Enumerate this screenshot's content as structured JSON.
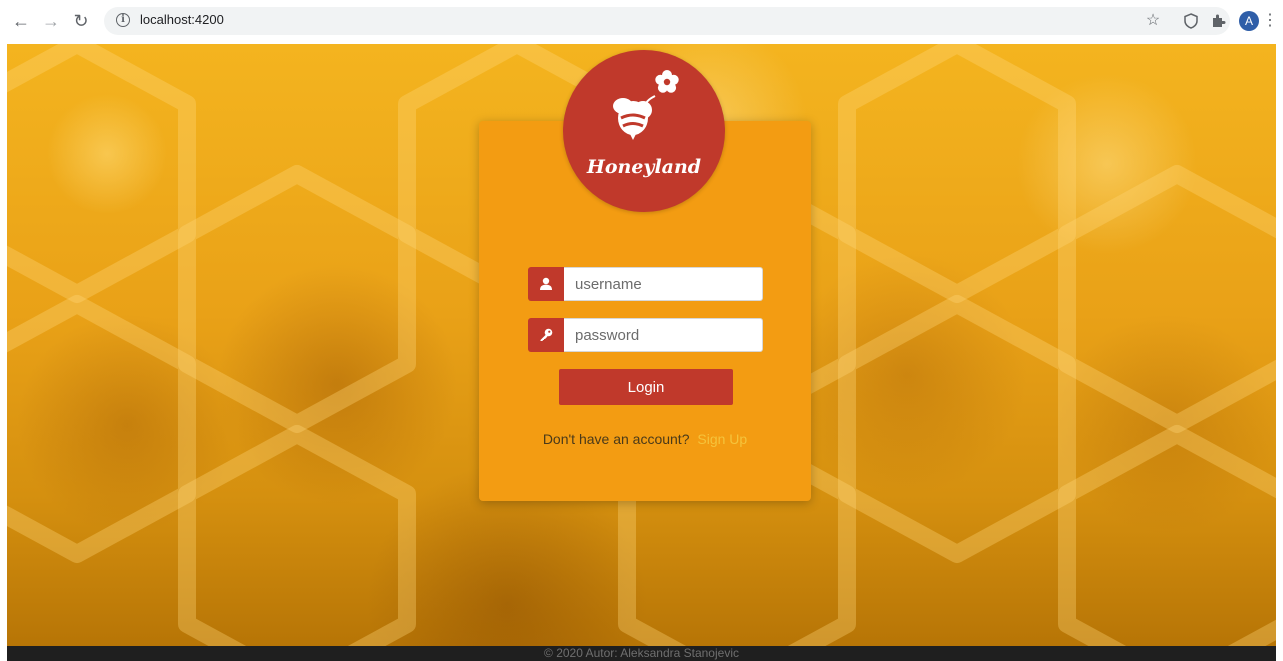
{
  "browser": {
    "url": "localhost:4200",
    "profile_initial": "A",
    "icons": {
      "back": "arrow-left-icon",
      "forward": "arrow-right-icon",
      "reload": "reload-icon",
      "site_info": "info-icon",
      "bookmark": "star-icon",
      "extension": "shield-icon",
      "extensions_menu": "puzzle-icon",
      "menu": "kebab-menu-icon"
    }
  },
  "logo": {
    "brand": "Honeyland",
    "icon": "bee-flower-icon"
  },
  "form": {
    "username_placeholder": "username",
    "password_placeholder": "password",
    "username_icon": "user-icon",
    "password_icon": "key-icon",
    "login_label": "Login",
    "signup_prompt": "Don't have an account?",
    "signup_link": "Sign Up"
  },
  "footer": {
    "text": "© 2020 Autor: Aleksandra Stanojevic"
  },
  "colors": {
    "card": "#f39c12",
    "accent_red": "#c0392b",
    "link": "#f5c33b"
  }
}
